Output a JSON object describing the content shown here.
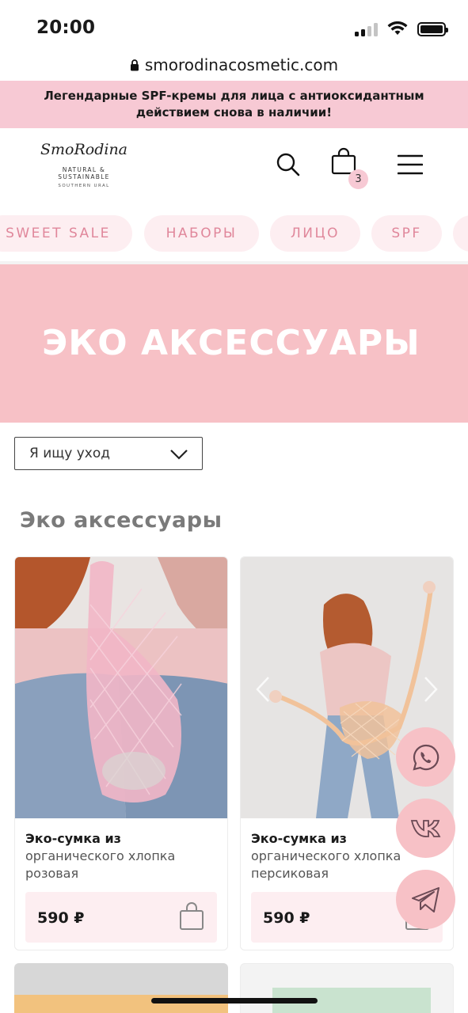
{
  "status_bar": {
    "time": "20:00"
  },
  "browser": {
    "url": "smorodinacosmetic.com"
  },
  "announcement": "Легендарные SPF-кремы для лица с антиоксидантным действием снова в наличии!",
  "logo": {
    "script": "SmoRodina",
    "tagline": "NATURAL & SUSTAINABLE",
    "region": "SOUTHERN URAL"
  },
  "header": {
    "cart_count": "3"
  },
  "categories": [
    "SWEET SALE",
    "НАБОРЫ",
    "ЛИЦО",
    "SPF"
  ],
  "hero": {
    "title": "ЭКО АКСЕССУАРЫ"
  },
  "filter": {
    "label": "Я ищу уход"
  },
  "section_title": "Эко аксессуары",
  "products": [
    {
      "name_bold": "Эко-сумка из",
      "name_rest": "органического хлопка розовая",
      "price": "590 ₽",
      "bag_color": "#f2b6c6"
    },
    {
      "name_bold": "Эко-сумка из",
      "name_rest": "органического хлопка персиковая",
      "price": "590 ₽",
      "bag_color": "#f1c29a"
    }
  ],
  "colors": {
    "accent_pink": "#f7c1c6",
    "chip_bg": "#fdeef1",
    "chip_text": "#e0879b",
    "announce_bg": "#f7c9d4"
  },
  "fabs": [
    "whatsapp-icon",
    "vk-icon",
    "telegram-icon"
  ]
}
